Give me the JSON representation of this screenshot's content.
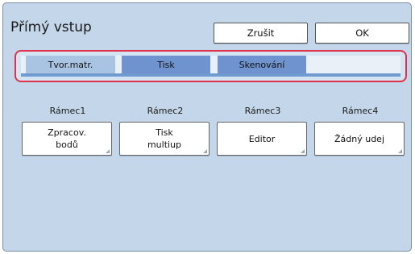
{
  "header": {
    "title": "Přímý vstup",
    "cancel_label": "Zrušit",
    "ok_label": "OK"
  },
  "tabs": [
    {
      "label": "Tvor.matr.",
      "active": true
    },
    {
      "label": "Tisk",
      "active": false
    },
    {
      "label": "Skenování",
      "active": false
    }
  ],
  "frames": [
    {
      "label": "Rámec1",
      "button": "Zpracov.\nbodů"
    },
    {
      "label": "Rámec2",
      "button": "Tisk\nmultiup"
    },
    {
      "label": "Rámec3",
      "button": "Editor"
    },
    {
      "label": "Rámec4",
      "button": "Žádný udej"
    }
  ],
  "colors": {
    "panel_bg": "#c4d7ea",
    "highlight_border": "#e0304a",
    "tab_active": "#a9c4e2",
    "tab_inactive": "#6f93cf"
  }
}
